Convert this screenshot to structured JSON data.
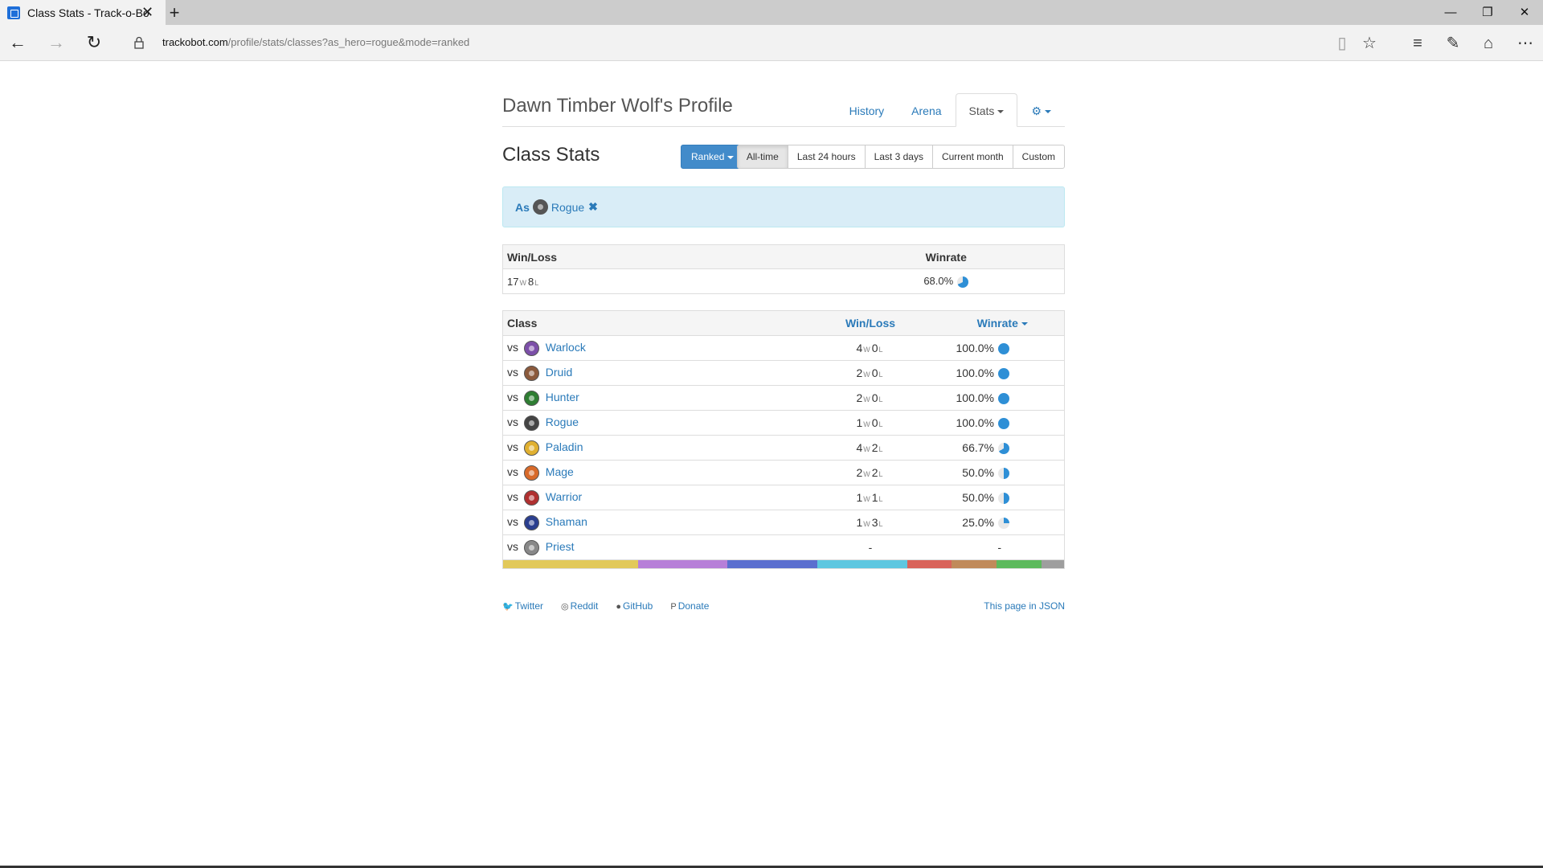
{
  "browser": {
    "tab_title": "Class Stats - Track-o-Bo",
    "url_domain": "trackobot.com",
    "url_path": "/profile/stats/classes?as_hero=rogue&mode=ranked"
  },
  "header": {
    "profile_title": "Dawn Timber Wolf's Profile",
    "nav": {
      "history": "History",
      "arena": "Arena",
      "stats": "Stats"
    }
  },
  "toolbar": {
    "page_title": "Class Stats",
    "mode": "Ranked",
    "ranges": [
      "All-time",
      "Last 24 hours",
      "Last 3 days",
      "Current month",
      "Custom"
    ],
    "active_range": "All-time"
  },
  "filter": {
    "prefix": "As",
    "hero": "Rogue",
    "hero_color": "#555555"
  },
  "summary": {
    "headers": {
      "winloss": "Win/Loss",
      "winrate": "Winrate"
    },
    "wins": "17",
    "losses": "8",
    "winrate": "68.0%",
    "winrate_value": 68.0
  },
  "classes": {
    "headers": {
      "class": "Class",
      "winloss": "Win/Loss",
      "winrate": "Winrate"
    },
    "rows": [
      {
        "vs": "vs",
        "name": "Warlock",
        "wins": "4",
        "losses": "0",
        "winrate": "100.0%",
        "value": 100,
        "color": "#7c4fa8"
      },
      {
        "vs": "vs",
        "name": "Druid",
        "wins": "2",
        "losses": "0",
        "winrate": "100.0%",
        "value": 100,
        "color": "#8b5a3c"
      },
      {
        "vs": "vs",
        "name": "Hunter",
        "wins": "2",
        "losses": "0",
        "winrate": "100.0%",
        "value": 100,
        "color": "#2e7d32"
      },
      {
        "vs": "vs",
        "name": "Rogue",
        "wins": "1",
        "losses": "0",
        "winrate": "100.0%",
        "value": 100,
        "color": "#444444"
      },
      {
        "vs": "vs",
        "name": "Paladin",
        "wins": "4",
        "losses": "2",
        "winrate": "66.7%",
        "value": 66.7,
        "color": "#e0b030"
      },
      {
        "vs": "vs",
        "name": "Mage",
        "wins": "2",
        "losses": "2",
        "winrate": "50.0%",
        "value": 50,
        "color": "#d86a2a"
      },
      {
        "vs": "vs",
        "name": "Warrior",
        "wins": "1",
        "losses": "1",
        "winrate": "50.0%",
        "value": 50,
        "color": "#b03030"
      },
      {
        "vs": "vs",
        "name": "Shaman",
        "wins": "1",
        "losses": "3",
        "winrate": "25.0%",
        "value": 25,
        "color": "#2b3f8f"
      },
      {
        "vs": "vs",
        "name": "Priest",
        "wins": "",
        "losses": "",
        "winrate": "-",
        "value": null,
        "wl_text": "-",
        "color": "#888888"
      }
    ]
  },
  "colorbar": [
    {
      "color": "#e2c95a",
      "share": 24
    },
    {
      "color": "#b77fd8",
      "share": 16
    },
    {
      "color": "#5b6fcf",
      "share": 16
    },
    {
      "color": "#5ec7e0",
      "share": 16
    },
    {
      "color": "#d9635a",
      "share": 8
    },
    {
      "color": "#c08a5a",
      "share": 8
    },
    {
      "color": "#5cba5c",
      "share": 8
    },
    {
      "color": "#9e9e9e",
      "share": 4
    }
  ],
  "footer": {
    "twitter": "Twitter",
    "reddit": "Reddit",
    "github": "GitHub",
    "donate": "Donate",
    "json": "This page in JSON"
  },
  "colors": {
    "link": "#2a7ab9",
    "pie": "#2e8fd6",
    "pie_bg": "#e8e8e8"
  }
}
